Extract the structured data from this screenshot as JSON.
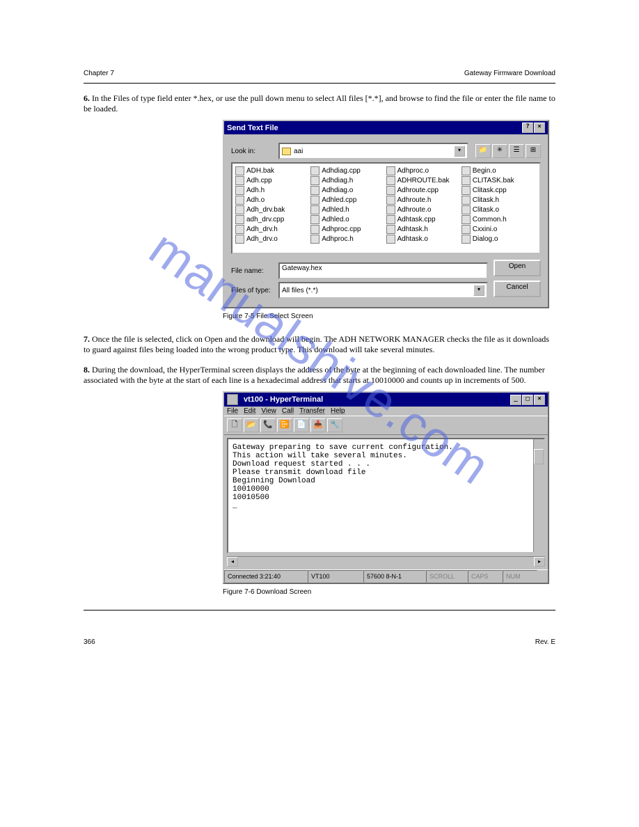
{
  "header": {
    "left": "Chapter 7",
    "right": "Gateway Firmware Download"
  },
  "step6": {
    "num": "6.",
    "text": "In the Files of type field enter *.hex, or use the pull down menu to select All files [*.*], and browse to find the file or enter the file name to be loaded."
  },
  "step7": {
    "num": "7.",
    "text": "Once the file is selected, click on Open and the download will begin. The ADH NETWORK MANAGER checks the file as it downloads to guard against files being loaded into the wrong product type. This download will take several minutes."
  },
  "step8": {
    "num": "8.",
    "text": "During the download, the HyperTerminal screen displays the address of the byte at the beginning of each downloaded line. The number associated with the byte at the start of each line is a hexadecimal address that starts at 10010000 and counts up in increments of 500."
  },
  "dialog": {
    "title": "Send Text File",
    "lookin_label": "Look in:",
    "lookin_value": "aai",
    "filename_label": "File name:",
    "filename_value": "Gateway.hex",
    "filetype_label": "Files of type:",
    "filetype_value": "All files (*.*)",
    "open": "Open",
    "cancel": "Cancel",
    "files": {
      "col1": [
        "ADH.bak",
        "Adh.cpp",
        "Adh.h",
        "Adh.o",
        "Adh_drv.bak",
        "adh_drv.cpp",
        "Adh_drv.h",
        "Adh_drv.o"
      ],
      "col2": [
        "Adhdiag.cpp",
        "Adhdiag.h",
        "Adhdiag.o",
        "Adhled.cpp",
        "Adhled.h",
        "Adhled.o",
        "Adhproc.cpp",
        "Adhproc.h"
      ],
      "col3": [
        "Adhproc.o",
        "ADHROUTE.bak",
        "Adhroute.cpp",
        "Adhroute.h",
        "Adhroute.o",
        "Adhtask.cpp",
        "Adhtask.h",
        "Adhtask.o"
      ],
      "col4": [
        "Begin.o",
        "CLITASK.bak",
        "Clitask.cpp",
        "Clitask.h",
        "Clitask.o",
        "Common.h",
        "Cxxini.o",
        "Dialog.o"
      ]
    }
  },
  "fig1": "Figure 7-5   File Select Screen",
  "fig2": "Figure 7-6   Download Screen",
  "hyperterm": {
    "title": "vt100 - HyperTerminal",
    "menu": [
      "File",
      "Edit",
      "View",
      "Call",
      "Transfer",
      "Help"
    ],
    "lines": [
      "Gateway preparing to save current configuration.",
      "This action will take several minutes.",
      "Download request started . . .",
      "Please transmit download file",
      "Beginning Download",
      "10010000",
      "10010500",
      "_"
    ],
    "status": {
      "conn": "Connected 3:21:40",
      "term": "VT100",
      "baud": "57600 8-N-1",
      "scroll": "SCROLL",
      "caps": "CAPS",
      "num": "NUM"
    }
  },
  "footer": {
    "left": "366",
    "center": "",
    "right": "Rev. E"
  },
  "watermark": "manualshive.com"
}
